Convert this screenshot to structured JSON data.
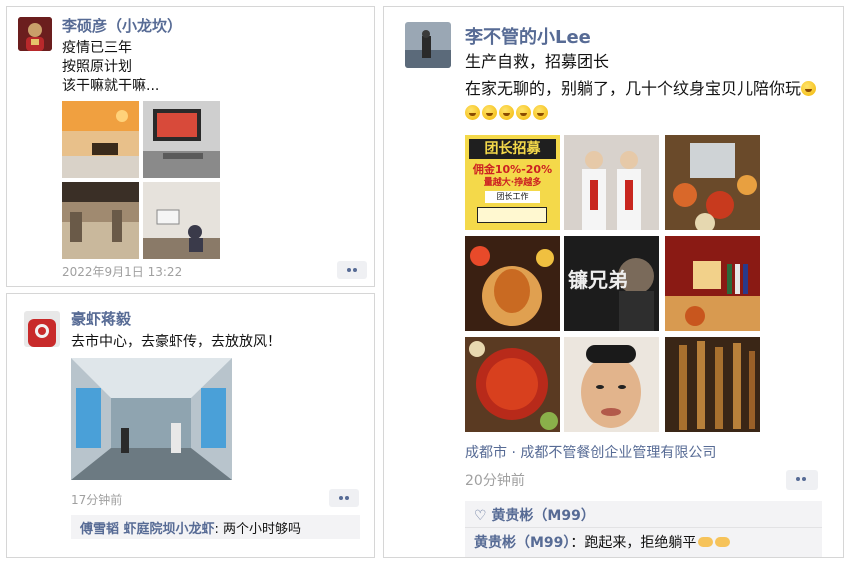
{
  "post1": {
    "author": "李硕彦（小龙坎）",
    "lines": [
      "疫情已三年",
      "按照原计划",
      "该干嘛就干嘛..."
    ],
    "timestamp": "2022年9月1日 13:22"
  },
  "post2": {
    "author": "豪虾蒋毅",
    "text": "去市中心，去豪虾传，去放放风！",
    "timestamp": "17分钟前",
    "comment": {
      "names": "傅雪韬 虾庭院坝小龙虾",
      "text": ": 两个小时够吗"
    }
  },
  "post3": {
    "author": "李不管的小Lee",
    "line1": "生产自救，招募团长",
    "line2": "在家无聊的，别躺了，几十个纹身宝贝儿陪你玩",
    "location": "成都市 · 成都不管餐创企业管理有限公司",
    "timestamp": "20分钟前",
    "like_name": "黄贵彬（M99）",
    "comment": {
      "name": "黄贵彬（M99）",
      "text": "：跑起来，拒绝躺平"
    },
    "poster": {
      "title": "团长招募",
      "subtitle": "佣金10%-20%",
      "subtitle2": "量越大·挣越多",
      "section": "团长工作"
    },
    "brothers_text": "镰兄弟"
  },
  "colors": {
    "name_link": "#576b95",
    "meta_gray": "#a0a0a0",
    "comment_bg": "#f3f3f5"
  }
}
